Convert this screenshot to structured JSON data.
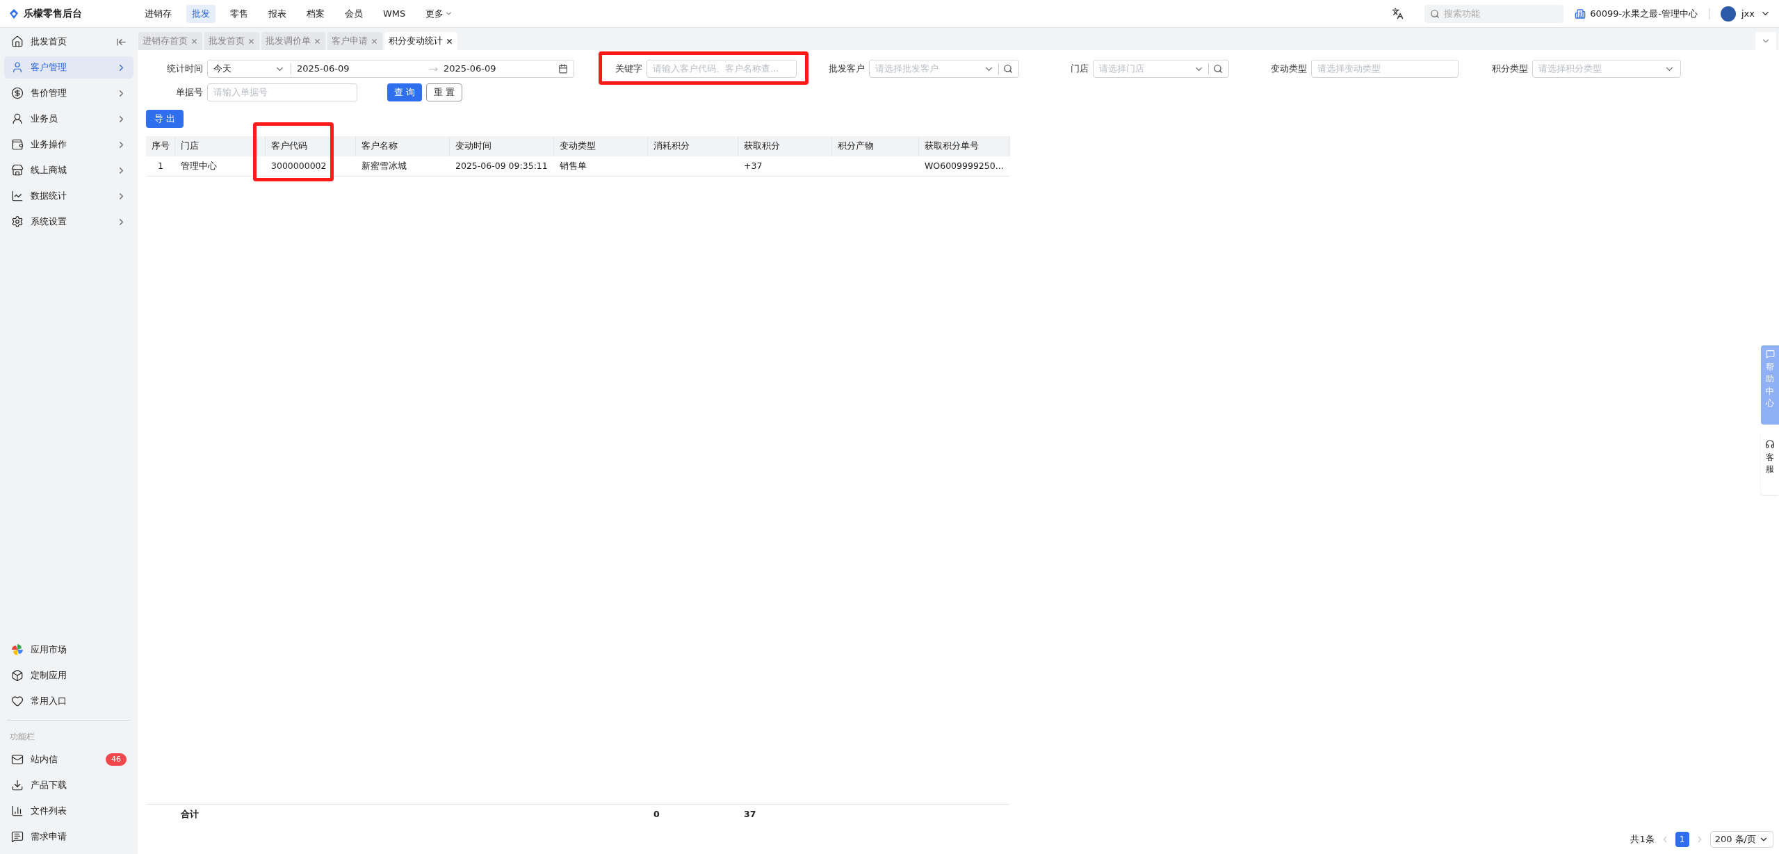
{
  "brand": {
    "name": "乐檬零售后台"
  },
  "top_nav": [
    {
      "label": "进销存",
      "selected": false
    },
    {
      "label": "批发",
      "selected": true
    },
    {
      "label": "零售",
      "selected": false
    },
    {
      "label": "报表",
      "selected": false
    },
    {
      "label": "档案",
      "selected": false
    },
    {
      "label": "会员",
      "selected": false
    },
    {
      "label": "WMS",
      "selected": false
    },
    {
      "label": "更多",
      "selected": false,
      "kind": "dropdown"
    }
  ],
  "header": {
    "search_placeholder": "搜索功能",
    "org": "60099-水果之最-管理中心",
    "user": "jxx"
  },
  "sidebar": {
    "items": [
      {
        "label": "批发首页",
        "kind": "collapse",
        "selected": false
      },
      {
        "label": "客户管理",
        "kind": "arrow",
        "selected": true
      },
      {
        "label": "售价管理",
        "kind": "arrow",
        "selected": false
      },
      {
        "label": "业务员",
        "kind": "arrow",
        "selected": false
      },
      {
        "label": "业务操作",
        "kind": "arrow",
        "selected": false
      },
      {
        "label": "线上商城",
        "kind": "arrow",
        "selected": false
      },
      {
        "label": "数据统计",
        "kind": "arrow",
        "selected": false
      },
      {
        "label": "系统设置",
        "kind": "arrow",
        "selected": false
      }
    ],
    "apps": [
      {
        "label": "应用市场"
      },
      {
        "label": "定制应用"
      },
      {
        "label": "常用入口"
      }
    ],
    "section_title": "功能栏",
    "tools": [
      {
        "label": "站内信",
        "badge": "46"
      },
      {
        "label": "产品下载"
      },
      {
        "label": "文件列表"
      },
      {
        "label": "需求申请"
      }
    ]
  },
  "tabs": [
    {
      "label": "进销存首页",
      "selected": false
    },
    {
      "label": "批发首页",
      "selected": false
    },
    {
      "label": "批发调价单",
      "selected": false
    },
    {
      "label": "客户申请",
      "selected": false
    },
    {
      "label": "积分变动统计",
      "selected": true
    }
  ],
  "filters": {
    "period": {
      "label": "统计时间",
      "preset": "今天",
      "start": "2025-06-09",
      "end": "2025-06-09"
    },
    "keyword": {
      "label": "关键字",
      "placeholder": "请输入客户代码、客户名称查..."
    },
    "customer": {
      "label": "批发客户",
      "placeholder": "请选择批发客户"
    },
    "store": {
      "label": "门店",
      "placeholder": "请选择门店"
    },
    "change_type": {
      "label": "变动类型",
      "placeholder": "请选择变动类型"
    },
    "points_type": {
      "label": "积分类型",
      "placeholder": "请选择积分类型"
    },
    "doc_no": {
      "label": "单据号",
      "placeholder": "请输入单据号"
    },
    "query_button": "查 询",
    "reset_button": "重 置"
  },
  "export_button": "导 出",
  "table": {
    "columns": [
      "序号",
      "门店",
      "客户代码",
      "客户名称",
      "变动时间",
      "变动类型",
      "消耗积分",
      "获取积分",
      "积分产物",
      "获取积分单号"
    ],
    "rows": [
      [
        "1",
        "管理中心",
        "3000000002",
        "新蜜雪冰城",
        "2025-06-09 09:35:11",
        "销售单",
        "",
        "+37",
        "",
        "WO6009999250..."
      ]
    ],
    "summary": {
      "label": "合计",
      "consumed": "0",
      "earned": "37"
    }
  },
  "pagination": {
    "total": "共1条",
    "pages": [
      {
        "label": "1",
        "selected": true
      }
    ],
    "page_size": "200 条/页"
  },
  "float_help": {
    "help": "帮助中心",
    "service": "客服"
  }
}
